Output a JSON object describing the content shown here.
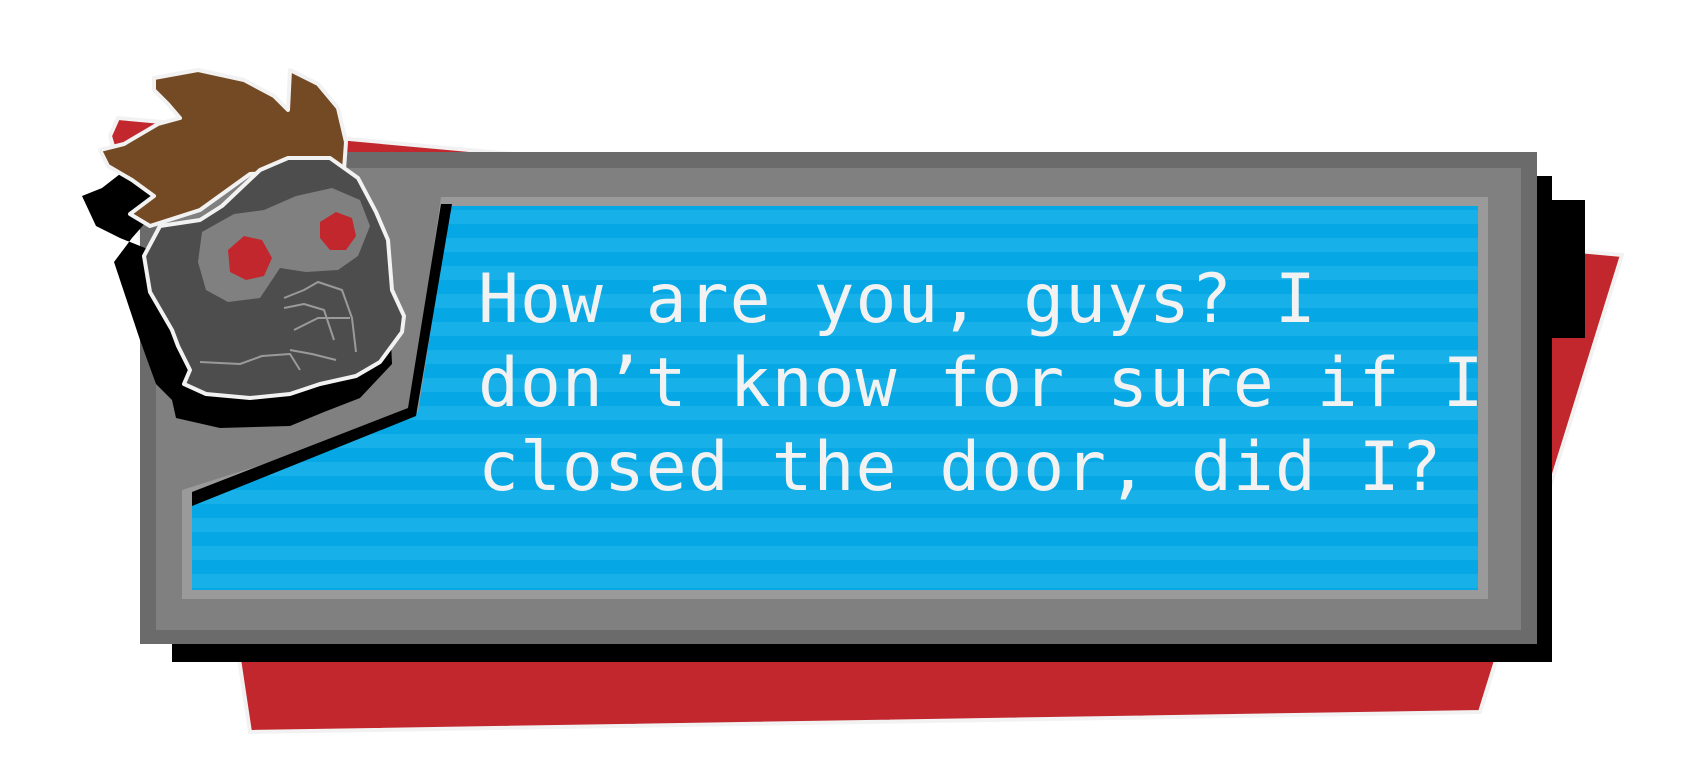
{
  "dialog": {
    "lines": [
      "How are you, guys? I",
      "don’t know for sure if I",
      "closed the door, did I?"
    ]
  },
  "speaker": {
    "portrait_icon": "masked-helmet-portrait-icon",
    "eye_color": "#c1272d",
    "hair_color": "#744a25",
    "helmet_color": "#4d4d4d"
  },
  "colors": {
    "accent_red": "#c1272d",
    "dark_red": "#a81f24",
    "frame_gray": "#808080",
    "frame_dark_gray": "#6b6b6b",
    "screen_blue": "#05a7e4",
    "screen_border": "#9a9a9a",
    "text": "#f2f2f2"
  }
}
